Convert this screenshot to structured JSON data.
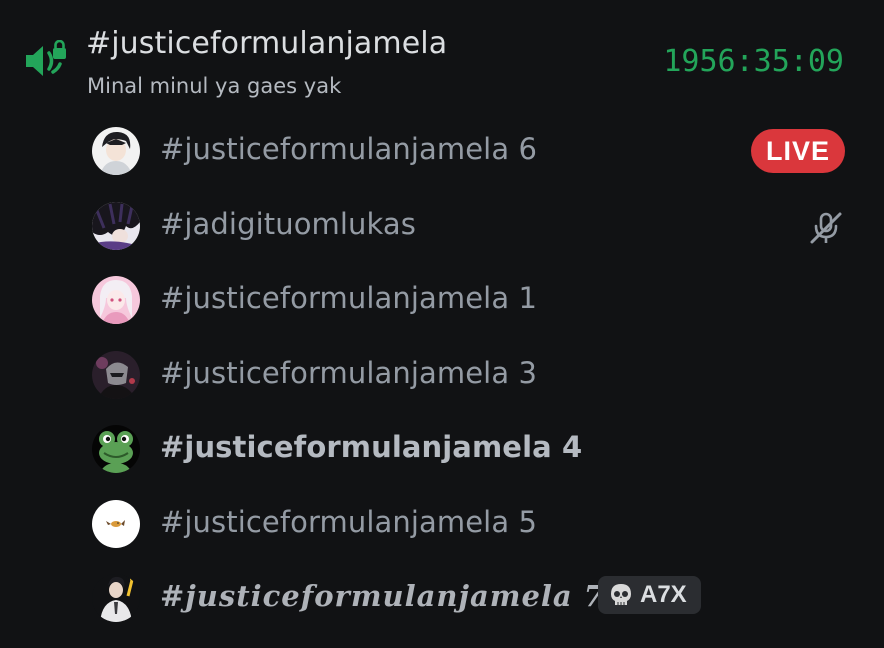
{
  "channel": {
    "icon": "voice-channel-locked-icon",
    "name": "#justiceformulanjamela",
    "status": "Minal minul ya gaes yak",
    "timer": "1956:35:09"
  },
  "users": [
    {
      "name": "#justiceformulanjamela 6",
      "avatar": "anime-boy-avatar",
      "live_label": "LIVE"
    },
    {
      "name": "#jadigituomlukas",
      "avatar": "dark-hair-avatar",
      "muted_icon": "microphone-muted-icon"
    },
    {
      "name": "#justiceformulanjamela 1",
      "avatar": "pink-anime-girl-avatar"
    },
    {
      "name": "#justiceformulanjamela 3",
      "avatar": "dark-figure-avatar"
    },
    {
      "name": "#justiceformulanjamela 4",
      "avatar": "frog-avatar"
    },
    {
      "name": "#justiceformulanjamela 5",
      "avatar": "small-bird-avatar"
    },
    {
      "name": "#justiceformulanjamela 7",
      "avatar": "suit-boy-avatar",
      "tag": {
        "icon": "skull-icon",
        "label": "A7X"
      }
    }
  ],
  "colors": {
    "background": "#111214",
    "voice_green": "#23a55a",
    "live_red": "#da373c",
    "muted_text": "#949ba4"
  }
}
